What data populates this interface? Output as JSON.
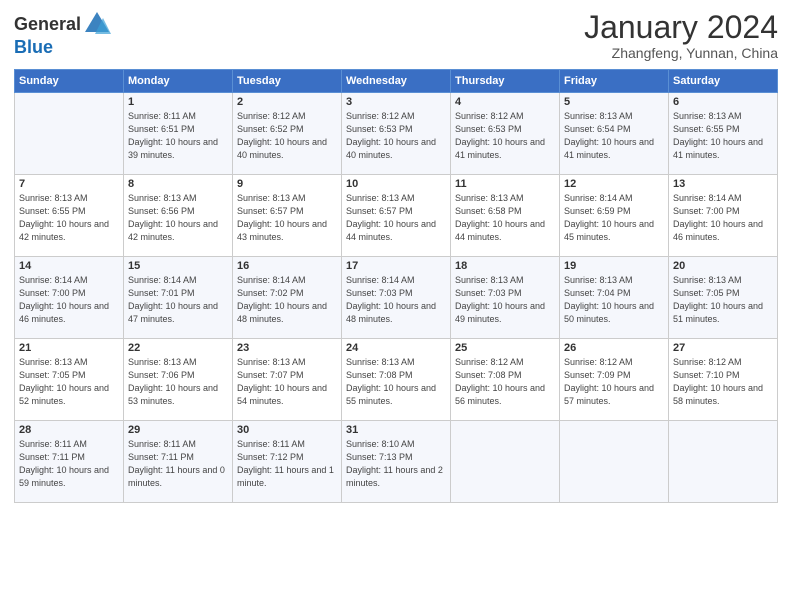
{
  "logo": {
    "general": "General",
    "blue": "Blue"
  },
  "title": "January 2024",
  "location": "Zhangfeng, Yunnan, China",
  "headers": [
    "Sunday",
    "Monday",
    "Tuesday",
    "Wednesday",
    "Thursday",
    "Friday",
    "Saturday"
  ],
  "weeks": [
    [
      {
        "day": "",
        "sunrise": "",
        "sunset": "",
        "daylight": ""
      },
      {
        "day": "1",
        "sunrise": "Sunrise: 8:11 AM",
        "sunset": "Sunset: 6:51 PM",
        "daylight": "Daylight: 10 hours and 39 minutes."
      },
      {
        "day": "2",
        "sunrise": "Sunrise: 8:12 AM",
        "sunset": "Sunset: 6:52 PM",
        "daylight": "Daylight: 10 hours and 40 minutes."
      },
      {
        "day": "3",
        "sunrise": "Sunrise: 8:12 AM",
        "sunset": "Sunset: 6:53 PM",
        "daylight": "Daylight: 10 hours and 40 minutes."
      },
      {
        "day": "4",
        "sunrise": "Sunrise: 8:12 AM",
        "sunset": "Sunset: 6:53 PM",
        "daylight": "Daylight: 10 hours and 41 minutes."
      },
      {
        "day": "5",
        "sunrise": "Sunrise: 8:13 AM",
        "sunset": "Sunset: 6:54 PM",
        "daylight": "Daylight: 10 hours and 41 minutes."
      },
      {
        "day": "6",
        "sunrise": "Sunrise: 8:13 AM",
        "sunset": "Sunset: 6:55 PM",
        "daylight": "Daylight: 10 hours and 41 minutes."
      }
    ],
    [
      {
        "day": "7",
        "sunrise": "Sunrise: 8:13 AM",
        "sunset": "Sunset: 6:55 PM",
        "daylight": "Daylight: 10 hours and 42 minutes."
      },
      {
        "day": "8",
        "sunrise": "Sunrise: 8:13 AM",
        "sunset": "Sunset: 6:56 PM",
        "daylight": "Daylight: 10 hours and 42 minutes."
      },
      {
        "day": "9",
        "sunrise": "Sunrise: 8:13 AM",
        "sunset": "Sunset: 6:57 PM",
        "daylight": "Daylight: 10 hours and 43 minutes."
      },
      {
        "day": "10",
        "sunrise": "Sunrise: 8:13 AM",
        "sunset": "Sunset: 6:57 PM",
        "daylight": "Daylight: 10 hours and 44 minutes."
      },
      {
        "day": "11",
        "sunrise": "Sunrise: 8:13 AM",
        "sunset": "Sunset: 6:58 PM",
        "daylight": "Daylight: 10 hours and 44 minutes."
      },
      {
        "day": "12",
        "sunrise": "Sunrise: 8:14 AM",
        "sunset": "Sunset: 6:59 PM",
        "daylight": "Daylight: 10 hours and 45 minutes."
      },
      {
        "day": "13",
        "sunrise": "Sunrise: 8:14 AM",
        "sunset": "Sunset: 7:00 PM",
        "daylight": "Daylight: 10 hours and 46 minutes."
      }
    ],
    [
      {
        "day": "14",
        "sunrise": "Sunrise: 8:14 AM",
        "sunset": "Sunset: 7:00 PM",
        "daylight": "Daylight: 10 hours and 46 minutes."
      },
      {
        "day": "15",
        "sunrise": "Sunrise: 8:14 AM",
        "sunset": "Sunset: 7:01 PM",
        "daylight": "Daylight: 10 hours and 47 minutes."
      },
      {
        "day": "16",
        "sunrise": "Sunrise: 8:14 AM",
        "sunset": "Sunset: 7:02 PM",
        "daylight": "Daylight: 10 hours and 48 minutes."
      },
      {
        "day": "17",
        "sunrise": "Sunrise: 8:14 AM",
        "sunset": "Sunset: 7:03 PM",
        "daylight": "Daylight: 10 hours and 48 minutes."
      },
      {
        "day": "18",
        "sunrise": "Sunrise: 8:13 AM",
        "sunset": "Sunset: 7:03 PM",
        "daylight": "Daylight: 10 hours and 49 minutes."
      },
      {
        "day": "19",
        "sunrise": "Sunrise: 8:13 AM",
        "sunset": "Sunset: 7:04 PM",
        "daylight": "Daylight: 10 hours and 50 minutes."
      },
      {
        "day": "20",
        "sunrise": "Sunrise: 8:13 AM",
        "sunset": "Sunset: 7:05 PM",
        "daylight": "Daylight: 10 hours and 51 minutes."
      }
    ],
    [
      {
        "day": "21",
        "sunrise": "Sunrise: 8:13 AM",
        "sunset": "Sunset: 7:05 PM",
        "daylight": "Daylight: 10 hours and 52 minutes."
      },
      {
        "day": "22",
        "sunrise": "Sunrise: 8:13 AM",
        "sunset": "Sunset: 7:06 PM",
        "daylight": "Daylight: 10 hours and 53 minutes."
      },
      {
        "day": "23",
        "sunrise": "Sunrise: 8:13 AM",
        "sunset": "Sunset: 7:07 PM",
        "daylight": "Daylight: 10 hours and 54 minutes."
      },
      {
        "day": "24",
        "sunrise": "Sunrise: 8:13 AM",
        "sunset": "Sunset: 7:08 PM",
        "daylight": "Daylight: 10 hours and 55 minutes."
      },
      {
        "day": "25",
        "sunrise": "Sunrise: 8:12 AM",
        "sunset": "Sunset: 7:08 PM",
        "daylight": "Daylight: 10 hours and 56 minutes."
      },
      {
        "day": "26",
        "sunrise": "Sunrise: 8:12 AM",
        "sunset": "Sunset: 7:09 PM",
        "daylight": "Daylight: 10 hours and 57 minutes."
      },
      {
        "day": "27",
        "sunrise": "Sunrise: 8:12 AM",
        "sunset": "Sunset: 7:10 PM",
        "daylight": "Daylight: 10 hours and 58 minutes."
      }
    ],
    [
      {
        "day": "28",
        "sunrise": "Sunrise: 8:11 AM",
        "sunset": "Sunset: 7:11 PM",
        "daylight": "Daylight: 10 hours and 59 minutes."
      },
      {
        "day": "29",
        "sunrise": "Sunrise: 8:11 AM",
        "sunset": "Sunset: 7:11 PM",
        "daylight": "Daylight: 11 hours and 0 minutes."
      },
      {
        "day": "30",
        "sunrise": "Sunrise: 8:11 AM",
        "sunset": "Sunset: 7:12 PM",
        "daylight": "Daylight: 11 hours and 1 minute."
      },
      {
        "day": "31",
        "sunrise": "Sunrise: 8:10 AM",
        "sunset": "Sunset: 7:13 PM",
        "daylight": "Daylight: 11 hours and 2 minutes."
      },
      {
        "day": "",
        "sunrise": "",
        "sunset": "",
        "daylight": ""
      },
      {
        "day": "",
        "sunrise": "",
        "sunset": "",
        "daylight": ""
      },
      {
        "day": "",
        "sunrise": "",
        "sunset": "",
        "daylight": ""
      }
    ]
  ]
}
